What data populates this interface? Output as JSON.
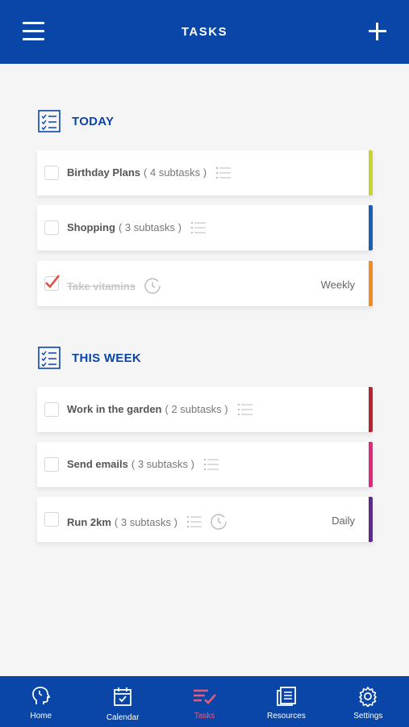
{
  "header": {
    "title": "TASKS"
  },
  "sections": [
    {
      "title": "TODAY",
      "tasks": [
        {
          "name": "Birthday Plans",
          "subtasks": "( 4 subtasks )",
          "frequency": "",
          "done": false,
          "color": "#c8d62b"
        },
        {
          "name": "Shopping",
          "subtasks": "( 3 subtasks )",
          "frequency": "",
          "done": false,
          "color": "#1a5fb4"
        },
        {
          "name": "Take vitamins",
          "subtasks": "",
          "frequency": "Weekly",
          "done": true,
          "color": "#f08a24"
        }
      ]
    },
    {
      "title": "THIS WEEK",
      "tasks": [
        {
          "name": "Work in the garden",
          "subtasks": "( 2 subtasks )",
          "frequency": "",
          "done": false,
          "color": "#b8232f"
        },
        {
          "name": "Send emails",
          "subtasks": "( 3 subtasks )",
          "frequency": "",
          "done": false,
          "color": "#e0287a"
        },
        {
          "name": "Run 2km",
          "subtasks": "( 3 subtasks )",
          "frequency": "Daily",
          "done": false,
          "color": "#5b2b8f"
        }
      ]
    }
  ],
  "tabs": [
    {
      "label": "Home",
      "icon": "head-icon"
    },
    {
      "label": "Calendar",
      "icon": "calendar-icon"
    },
    {
      "label": "Tasks",
      "icon": "tasks-icon",
      "active": true
    },
    {
      "label": "Resources",
      "icon": "resources-icon"
    },
    {
      "label": "Settings",
      "icon": "gear-icon"
    }
  ],
  "colors": {
    "brand": "#0a46a8",
    "active_tab": "#e55a7a",
    "check": "#e0483c"
  }
}
